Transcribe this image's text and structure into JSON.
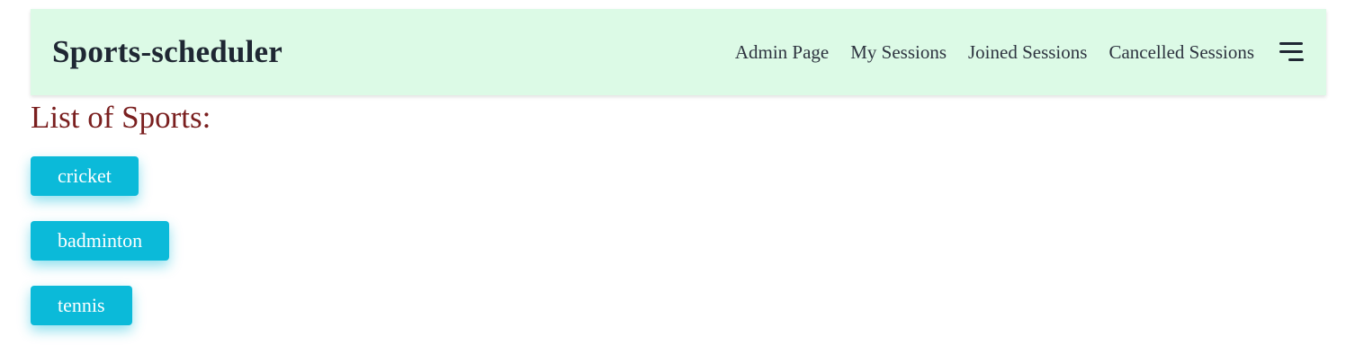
{
  "navbar": {
    "brand": "Sports-scheduler",
    "links": [
      "Admin Page",
      "My Sessions",
      "Joined Sessions",
      "Cancelled Sessions"
    ],
    "menu_icon": "hamburger-menu-icon",
    "background": "#dcfae6"
  },
  "main": {
    "heading": "List of Sports:",
    "heading_color": "#7a1f1f",
    "sports": [
      "cricket",
      "badminton",
      "tennis"
    ],
    "button_color": "#0bbad9"
  }
}
